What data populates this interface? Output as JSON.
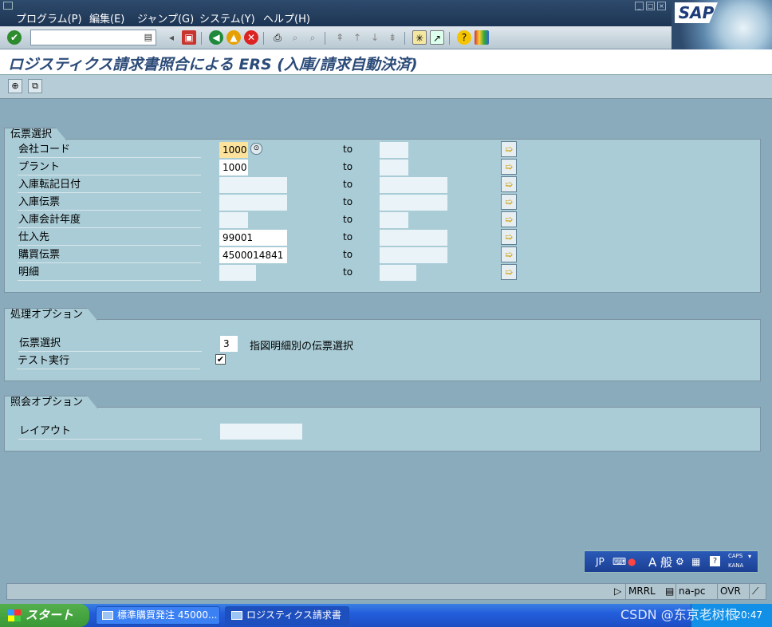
{
  "menu": {
    "items": [
      "プログラム(P)",
      "編集(E)",
      "ジャンプ(G)",
      "システム(Y)",
      "ヘルプ(H)"
    ],
    "sap_logo": "SAP"
  },
  "toolbar": {
    "command_value": "",
    "icons": [
      "enter-icon",
      "back-icon",
      "save-icon",
      "back-nav-icon",
      "exit-icon",
      "cancel-icon",
      "print-icon",
      "find-icon",
      "find-next-icon",
      "first-page-icon",
      "previous-page-icon",
      "next-page-icon",
      "last-page-icon",
      "new-session-icon",
      "shortcut-icon",
      "help-icon",
      "layout-icon"
    ]
  },
  "title": "ロジスティクス請求書照合による ERS (入庫/請求自動決済)",
  "app_toolbar": {
    "icons": [
      "execute-icon",
      "variant-icon"
    ]
  },
  "groups": {
    "selection": {
      "title": "伝票選択",
      "to_label": "to",
      "rows": [
        {
          "label": "会社コード",
          "from": "1000",
          "to": ""
        },
        {
          "label": "プラント",
          "from": "1000",
          "to": ""
        },
        {
          "label": "入庫転記日付",
          "from": "",
          "to": ""
        },
        {
          "label": "入庫伝票",
          "from": "",
          "to": ""
        },
        {
          "label": "入庫会計年度",
          "from": "",
          "to": ""
        },
        {
          "label": "仕入先",
          "from": "99001",
          "to": ""
        },
        {
          "label": "購買伝票",
          "from": "4500014841",
          "to": ""
        },
        {
          "label": "明細",
          "from": "",
          "to": ""
        }
      ]
    },
    "processing": {
      "title": "処理オプション",
      "doc_selection_label": "伝票選択",
      "doc_selection_value": "3",
      "doc_selection_desc": "指図明細別の伝票選択",
      "test_run_label": "テスト実行",
      "test_run_checked": "✔"
    },
    "display": {
      "title": "照会オプション",
      "layout_label": "レイアウト",
      "layout_value": ""
    }
  },
  "ime": {
    "lang": "JP",
    "mode": "A 般",
    "caps": "CAPS",
    "kana": "KANA"
  },
  "status": {
    "system": "MRRL",
    "host": "na-pc",
    "mode": "OVR"
  },
  "taskbar": {
    "start": "スタート",
    "tasks": [
      "標準購買発注 45000...",
      "ロジスティクス請求書照..."
    ],
    "clock": "20:47"
  },
  "watermark": "CSDN @东京老树根"
}
